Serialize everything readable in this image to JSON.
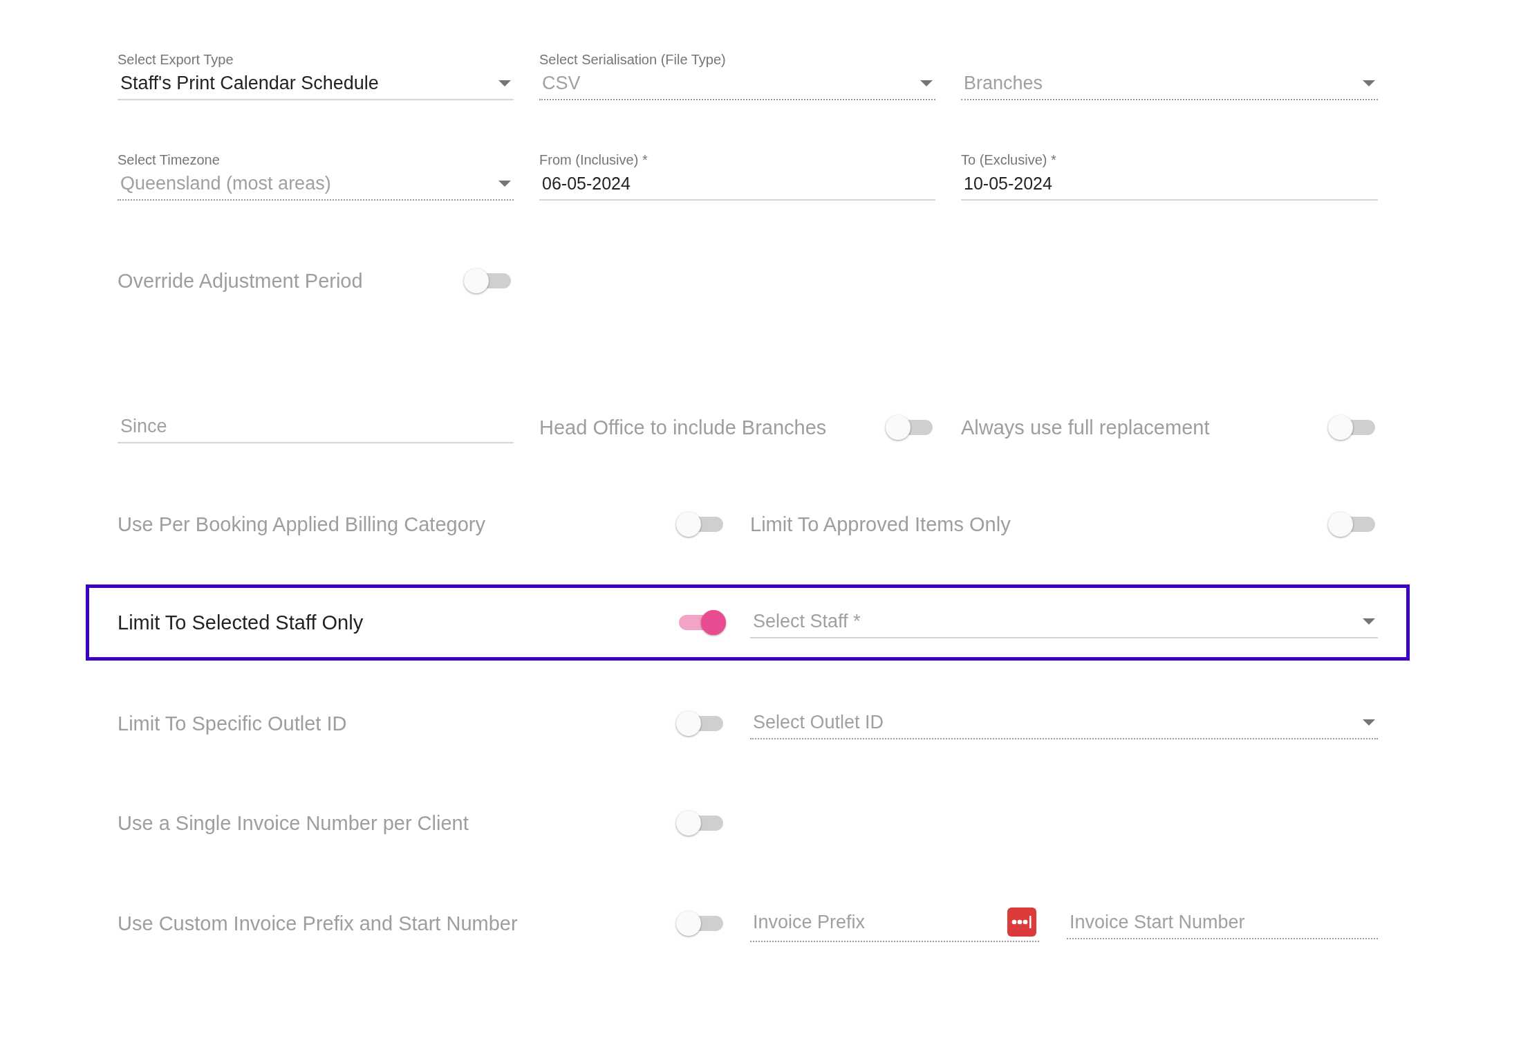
{
  "rows": [
    {
      "kind": "thirds",
      "highlighted": false,
      "items": [
        {
          "kind": "select",
          "label": "Select Export Type",
          "value": "Staff's Print Calendar Schedule",
          "disabled": false
        },
        {
          "kind": "select",
          "label": "Select Serialisation (File Type)",
          "value": "CSV",
          "disabled": true
        },
        {
          "kind": "select",
          "placeholder": "Branches",
          "disabled": true
        }
      ]
    },
    {
      "kind": "thirds",
      "highlighted": false,
      "items": [
        {
          "kind": "select",
          "label": "Select Timezone",
          "value": "Queensland (most areas)",
          "disabled": true
        },
        {
          "kind": "text",
          "label": "From (Inclusive) *",
          "value": "06-05-2024",
          "disabled": false
        },
        {
          "kind": "text",
          "label": "To (Exclusive) *",
          "value": "10-05-2024",
          "disabled": false
        }
      ]
    },
    {
      "kind": "thirds",
      "highlighted": false,
      "items": [
        {
          "kind": "toggle",
          "label": "Override Adjustment Period",
          "on": false
        }
      ]
    },
    {
      "kind": "thirds",
      "highlighted": false,
      "items": [
        {
          "kind": "text",
          "placeholder": "Since",
          "disabled": false
        },
        {
          "kind": "toggle",
          "label": "Head Office to include Branches",
          "on": false
        },
        {
          "kind": "toggle",
          "label": "Always use full replacement",
          "on": false
        }
      ]
    },
    {
      "kind": "split",
      "highlighted": false,
      "items": [
        {
          "kind": "toggle",
          "label": "Use Per Booking Applied Billing Category",
          "on": false
        },
        {
          "kind": "toggle",
          "label": "Limit To Approved Items Only",
          "on": false
        }
      ]
    },
    {
      "kind": "split",
      "highlighted": true,
      "items": [
        {
          "kind": "toggle",
          "label": "Limit To Selected Staff Only",
          "on": true
        },
        {
          "kind": "select",
          "placeholder": "Select Staff *",
          "disabled": false
        }
      ]
    },
    {
      "kind": "split",
      "highlighted": false,
      "items": [
        {
          "kind": "toggle",
          "label": "Limit To Specific Outlet ID",
          "on": false
        },
        {
          "kind": "select",
          "placeholder": "Select Outlet ID",
          "disabled": true
        }
      ]
    },
    {
      "kind": "split",
      "highlighted": false,
      "items": [
        {
          "kind": "toggle",
          "label": "Use a Single Invoice Number per Client",
          "on": false
        }
      ]
    },
    {
      "kind": "split",
      "highlighted": false,
      "items": [
        {
          "kind": "toggle",
          "label": "Use Custom Invoice Prefix and Start Number",
          "on": false
        },
        {
          "kind": "text",
          "placeholder": "Invoice Prefix",
          "disabled": true,
          "trailing_icon": true
        },
        {
          "kind": "text",
          "placeholder": "Invoice Start Number",
          "disabled": true
        }
      ]
    }
  ]
}
